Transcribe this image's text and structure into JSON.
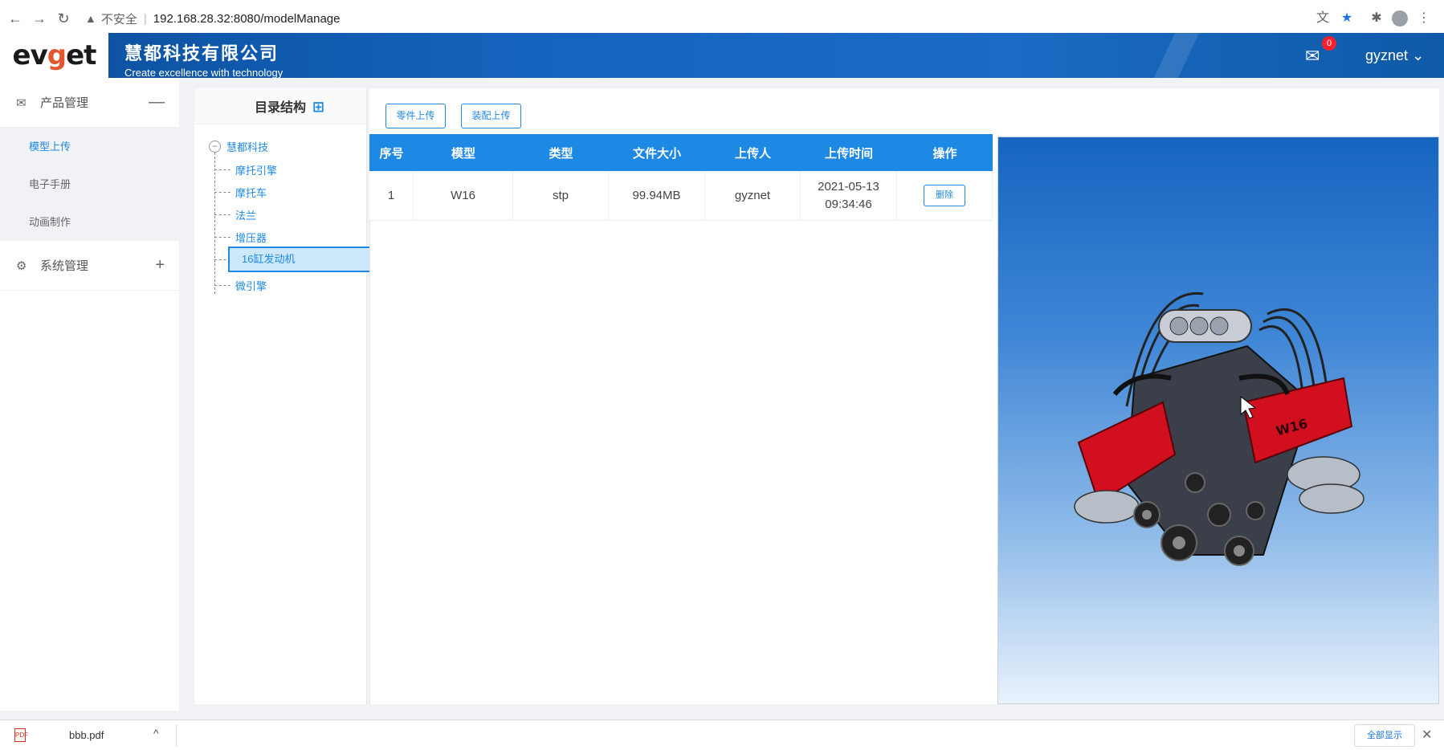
{
  "browser": {
    "security_label": "不安全",
    "url": "192.168.28.32:8080/modelManage"
  },
  "header": {
    "logo_prefix": "ev",
    "logo_g": "g",
    "logo_suffix": "et",
    "company_name": "慧都科技有限公司",
    "slogan": "Create excellence with technology",
    "mail_badge": "0",
    "username": "gyznet"
  },
  "sidebar": {
    "groups": [
      {
        "label": "产品管理",
        "toggle": "—",
        "items": [
          "模型上传",
          "电子手册",
          "动画制作"
        ]
      },
      {
        "label": "系统管理",
        "toggle": "+"
      }
    ]
  },
  "tree": {
    "title": "目录结构",
    "root": "慧都科技",
    "nodes": [
      "摩托引擎",
      "摩托车",
      "法兰",
      "增压器",
      "16缸发动机",
      "微引擎"
    ]
  },
  "toolbar": {
    "part_upload": "零件上传",
    "assembly_upload": "装配上传"
  },
  "table": {
    "headers": [
      "序号",
      "模型",
      "类型",
      "文件大小",
      "上传人",
      "上传时间",
      "操作"
    ],
    "rows": [
      {
        "index": "1",
        "model": "W16",
        "type": "stp",
        "size": "99.94MB",
        "uploader": "gyznet",
        "time": "2021-05-13 09:34:46",
        "action": "删除"
      }
    ]
  },
  "downloads": {
    "file": "bbb.pdf",
    "show_all": "全部显示"
  },
  "colors": {
    "primary": "#1e88e5",
    "header_blue": "#1565c0",
    "engine_red": "#d10f1f",
    "badge_red": "#f5222d"
  }
}
